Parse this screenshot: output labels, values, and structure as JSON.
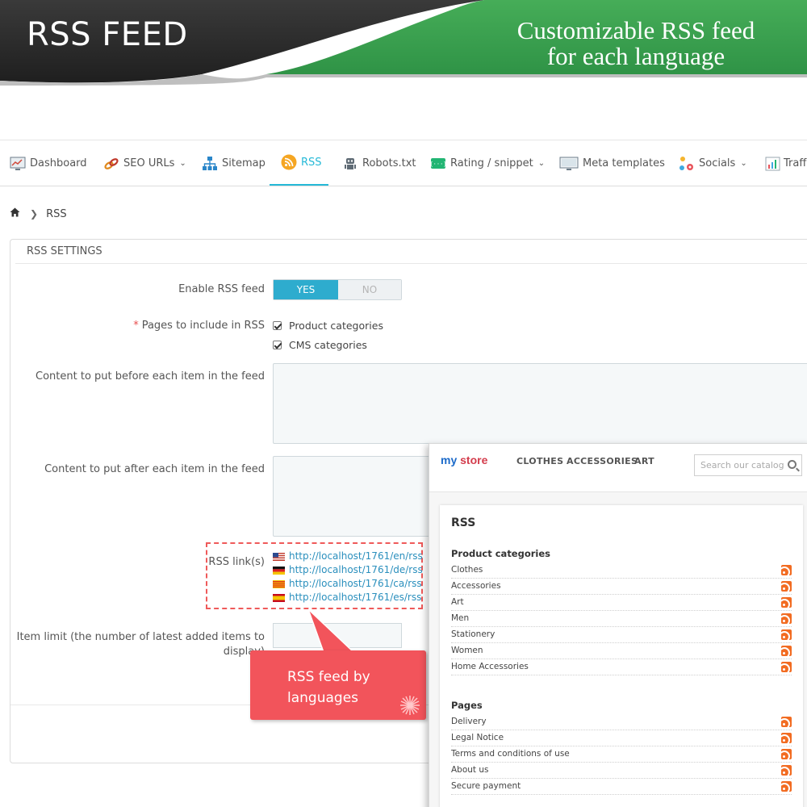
{
  "banner": {
    "title": "RSS FEED",
    "tagline_line1": "Customizable RSS feed",
    "tagline_line2": "for each language",
    "colors": {
      "dark": "#2b2b2b",
      "green": "#3aa24f"
    }
  },
  "tabs": [
    {
      "label": "Dashboard",
      "icon": "dashboard-icon"
    },
    {
      "label": "SEO URLs",
      "icon": "link-icon",
      "dropdown": true
    },
    {
      "label": "Sitemap",
      "icon": "sitemap-icon"
    },
    {
      "label": "RSS",
      "icon": "rss-icon",
      "active": true
    },
    {
      "label": "Robots.txt",
      "icon": "robot-icon"
    },
    {
      "label": "Rating / snippet",
      "icon": "snippet-icon",
      "dropdown": true
    },
    {
      "label": "Meta templates",
      "icon": "monitor-icon"
    },
    {
      "label": "Socials",
      "icon": "social-icon",
      "dropdown": true
    },
    {
      "label": "Traff",
      "icon": "traffic-chart-icon"
    }
  ],
  "breadcrumb": {
    "home_icon": "home-icon",
    "current": "RSS"
  },
  "panel": {
    "heading": "RSS SETTINGS",
    "enable_label": "Enable RSS feed",
    "toggle": {
      "yes": "YES",
      "no": "NO",
      "selected": "YES"
    },
    "pages_required_mark": "*",
    "pages_label": "Pages to include in RSS",
    "pages_options": [
      {
        "label": "Product categories",
        "checked": true
      },
      {
        "label": "CMS categories",
        "checked": true
      }
    ],
    "before_label": "Content to put before each item in the feed",
    "after_label": "Content to put after each item in the feed",
    "rss_links_label": "RSS link(s)",
    "rss_links": [
      {
        "flag": "us-flag-icon",
        "url": "http://localhost/1761/en/rss"
      },
      {
        "flag": "de-flag-icon",
        "url": "http://localhost/1761/de/rss"
      },
      {
        "flag": "ca-flag-icon",
        "url": "http://localhost/1761/ca/rss"
      },
      {
        "flag": "es-flag-icon",
        "url": "http://localhost/1761/es/rss"
      }
    ],
    "limit_label_line1": "Item limit (the number of latest added items to",
    "limit_label_line2": "display)"
  },
  "callout": {
    "line1": "RSS feed by",
    "line2": "languages",
    "color": "#f2545b"
  },
  "store": {
    "logo_my": "my",
    "logo_store": "store",
    "nav": [
      "CLOTHES",
      "ACCESSORIES",
      "ART"
    ],
    "search_placeholder": "Search our catalog",
    "card_title": "RSS",
    "product_categories_title": "Product categories",
    "product_categories": [
      "Clothes",
      "Accessories",
      "Art",
      "Men",
      "Stationery",
      "Women",
      "Home Accessories"
    ],
    "pages_title": "Pages",
    "pages": [
      "Delivery",
      "Legal Notice",
      "Terms and conditions of use",
      "About us",
      "Secure payment"
    ]
  }
}
